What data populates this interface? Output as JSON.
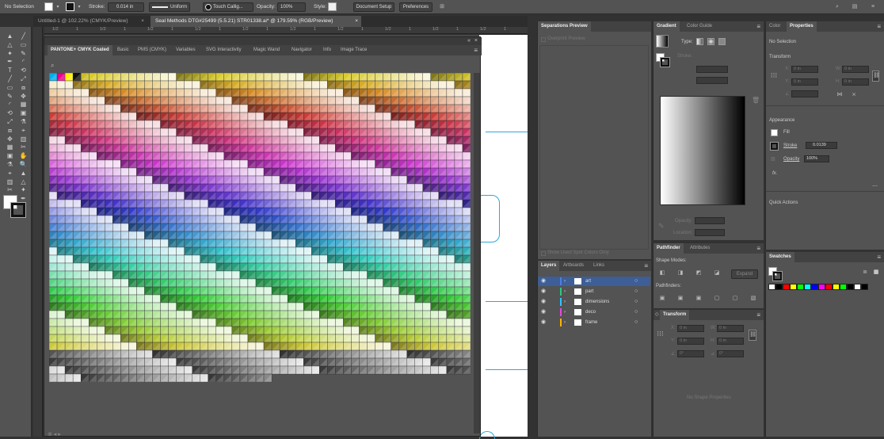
{
  "control_bar": {
    "selection": "No Selection",
    "stroke_label": "Stroke:",
    "stroke_value": "0.014 in",
    "stroke_profile": "Uniform",
    "brush": "Touch Callig...",
    "opacity_label": "Opacity:",
    "opacity_value": "100%",
    "style_label": "Style:",
    "document_setup": "Document Setup",
    "preferences": "Preferences"
  },
  "tabs": [
    {
      "label": "Untitled-1 @ 102.22% (CMYK/Preview)",
      "close": "×"
    },
    {
      "label": "Seal Methods DTG#25499 (5.5.21) STR01338.ai* @ 179.59% (RGB/Preview)",
      "close": "×"
    }
  ],
  "swatch_panel": {
    "tabs": [
      "PANTONE+ CMYK Coated",
      "Basic",
      "PMS (CMYK)",
      "Variables",
      "SVG Interactivity",
      "Magic Wand",
      "Navigator",
      "Info",
      "Image Trace"
    ]
  },
  "ruler_numbers": [
    "1/2",
    "1",
    "1/2",
    "1",
    "1/2",
    "1",
    "1/2",
    "1",
    "1/2",
    "1",
    "1/2",
    "1",
    "1/2",
    "1",
    "1/2",
    "1",
    "1/2",
    "1",
    "1/2",
    "1"
  ],
  "separations": {
    "title": "Separations Preview",
    "overprint": "Overprint Preview",
    "show_used": "Show Used Spot Colors Only"
  },
  "gradient": {
    "tabs": [
      "Gradient",
      "Color Guide"
    ],
    "type_label": "Type:",
    "stroke_label": "Stroke:",
    "opacity_label": "Opacity:",
    "location_label": "Location:"
  },
  "pathfinder": {
    "tabs": [
      "Pathfinder",
      "Attributes"
    ],
    "shape_modes": "Shape Modes:",
    "pathfinders": "Pathfinders:",
    "expand": "Expand"
  },
  "transform_panel": {
    "title": "Transform",
    "x": "X:",
    "y": "Y:",
    "w": "W:",
    "h": "H:",
    "field_value": "0 in",
    "angle_value": "0°",
    "empty": "No Shape Properties"
  },
  "layers": {
    "tabs": [
      "Layers",
      "Artboards",
      "Links"
    ],
    "items": [
      {
        "name": "art",
        "color": "#4f7de6"
      },
      {
        "name": "part",
        "color": "#31c77d"
      },
      {
        "name": "dimensions",
        "color": "#2ec4ff"
      },
      {
        "name": "deco",
        "color": "#e04be0"
      },
      {
        "name": "frame",
        "color": "#ffb300"
      }
    ]
  },
  "properties": {
    "tabs": [
      "Color",
      "Properties"
    ],
    "selection": "No Selection",
    "transform": "Transform",
    "x": "X:",
    "y": "Y:",
    "w": "W:",
    "h": "H:",
    "field_value": "0 in",
    "appearance": "Appearance",
    "fill": "Fill",
    "stroke": "Stroke",
    "stroke_value": "0.0139",
    "opacity": "Opacity",
    "opacity_value": "100%",
    "fx": "fx.",
    "quick_actions": "Quick Actions"
  },
  "swatches": {
    "title": "Swatches",
    "colors": [
      "#ffffff",
      "#000000",
      "#ff0000",
      "#ffff00",
      "#00ff00",
      "#00ffff",
      "#0000ff",
      "#ff00ff",
      "#ff0000",
      "#ffff00",
      "#00ff00",
      "#000000",
      "#ffffff",
      "#000000"
    ]
  },
  "icons": {
    "close": "×",
    "menu": "≡",
    "search": "search-icon"
  }
}
